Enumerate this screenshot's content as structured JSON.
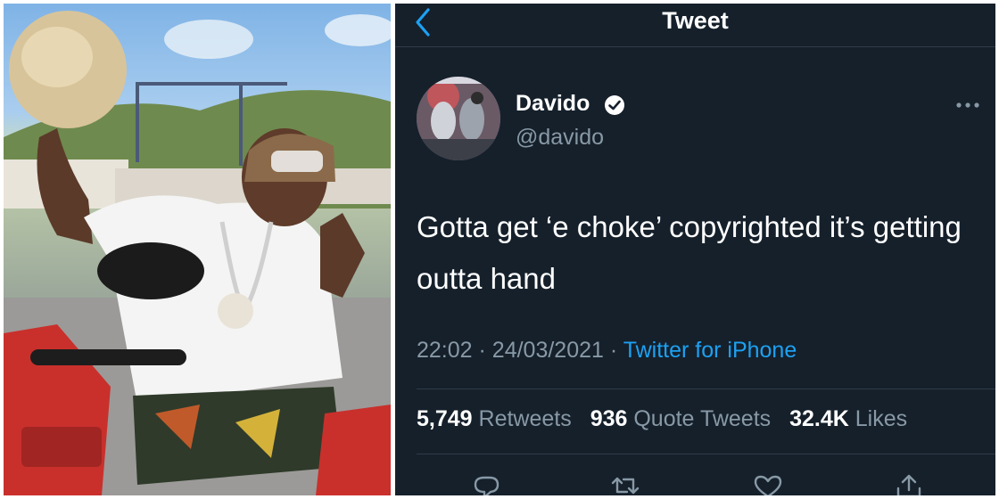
{
  "header": {
    "title": "Tweet"
  },
  "author": {
    "name": "Davido",
    "handle": "@davido",
    "verified": true
  },
  "tweet": {
    "text": "Gotta get ‘e choke’ copyrighted it’s getting outta hand",
    "time": "22:02",
    "separator": "·",
    "date": "24/03/2021",
    "source": "Twitter for iPhone"
  },
  "stats": {
    "retweets_count": "5,749",
    "retweets_label": "Retweets",
    "quotes_count": "936",
    "quotes_label": "Quote Tweets",
    "likes_count": "32.4K",
    "likes_label": "Likes"
  },
  "colors": {
    "background": "#15202b",
    "accent": "#1da1f2",
    "secondary_text": "#8899a6"
  },
  "icons": [
    "chevron-left-icon",
    "verified-badge-icon",
    "more-icon",
    "reply-icon",
    "retweet-icon",
    "like-icon",
    "share-icon"
  ]
}
